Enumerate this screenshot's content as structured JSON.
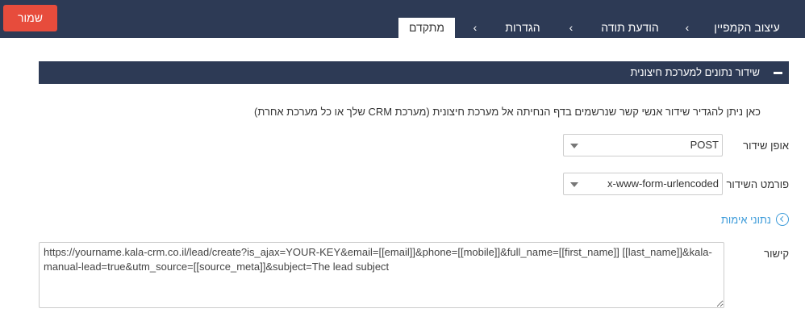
{
  "toolbar": {
    "save_label": "שמור"
  },
  "tabs": [
    {
      "label": "עיצוב הקמפיין",
      "active": false
    },
    {
      "label": "הודעת תודה",
      "active": false
    },
    {
      "label": "הגדרות",
      "active": false
    },
    {
      "label": "מתקדם",
      "active": true
    }
  ],
  "panel": {
    "title": "שידור נתונים למערכת חיצונית",
    "description": "כאן ניתן להגדיר שידור אנשי קשר שנרשמים בדף הנחיתה אל מערכת חיצונית (מערכת CRM שלך או כל מערכת אחרת)",
    "method": {
      "label": "אופן שידור",
      "value": "POST"
    },
    "format": {
      "label": "פורמט השידור",
      "value": "x-www-form-urlencoded"
    },
    "auth": {
      "label": "נתוני אימות"
    },
    "url": {
      "label": "קישור",
      "value": "https://yourname.kala-crm.co.il/lead/create?is_ajax=YOUR-KEY&email=[[email]]&phone=[[mobile]]&full_name=[[first_name]] [[last_name]]&kala-manual-lead=true&utm_source=[[source_meta]]&subject=The lead subject"
    }
  },
  "colors": {
    "topbar": "#2d3a55",
    "save_button": "#e74c3c",
    "link": "#3a9ad9"
  }
}
